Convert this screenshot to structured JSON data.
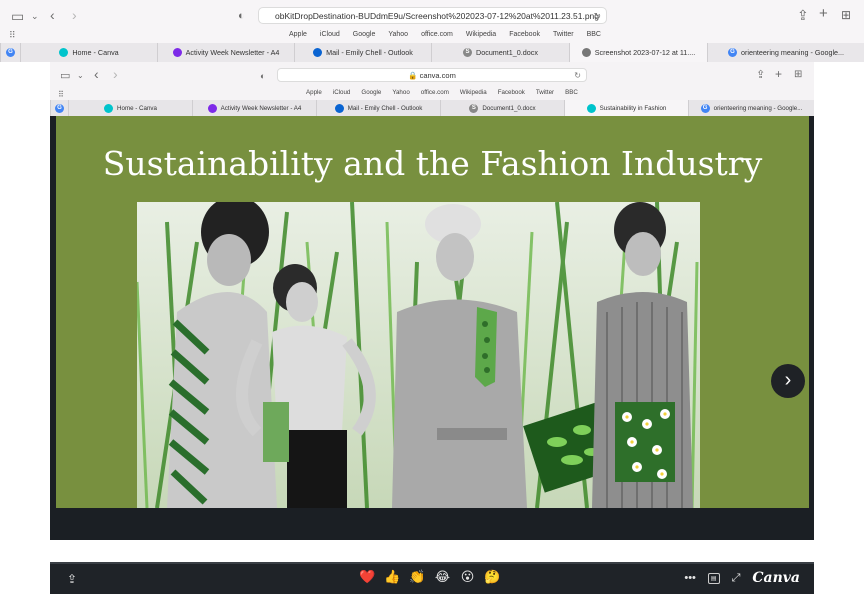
{
  "browser": {
    "url": "obKitDropDestination-BUDdmE9u/Screenshot%202023-07-12%20at%2011.23.51.png",
    "favorites": [
      "Apple",
      "iCloud",
      "Google",
      "Yahoo",
      "office.com",
      "Wikipedia",
      "Facebook",
      "Twitter",
      "BBC"
    ],
    "tabs": [
      {
        "label": "",
        "icon": "google-icon",
        "color": "#4285f4"
      },
      {
        "label": "Home - Canva",
        "icon": "canva-icon",
        "color": "#00c4cc"
      },
      {
        "label": "Activity Week Newsletter - A4",
        "icon": "canva-icon",
        "color": "#7d2ae8"
      },
      {
        "label": "Mail - Emily Chell - Outlook",
        "icon": "outlook-icon",
        "color": "#0a64d2"
      },
      {
        "label": "Document1_0.docx",
        "icon": "document-icon",
        "color": "#888888"
      },
      {
        "label": "Screenshot 2023-07-12 at 11....",
        "icon": "safari-icon",
        "color": "#777777"
      },
      {
        "label": "orienteering meaning - Google...",
        "icon": "google-icon",
        "color": "#4285f4"
      }
    ]
  },
  "inner": {
    "url": "canva.com",
    "favorites": [
      "Apple",
      "iCloud",
      "Google",
      "Yahoo",
      "office.com",
      "Wikipedia",
      "Facebook",
      "Twitter",
      "BBC"
    ],
    "tabs": [
      {
        "label": "",
        "icon": "google-icon",
        "color": "#4285f4"
      },
      {
        "label": "Home - Canva",
        "icon": "canva-icon",
        "color": "#00c4cc"
      },
      {
        "label": "Activity Week Newsletter - A4",
        "icon": "canva-icon",
        "color": "#7d2ae8"
      },
      {
        "label": "Mail - Emily Chell - Outlook",
        "icon": "outlook-icon",
        "color": "#0a64d2"
      },
      {
        "label": "Document1_0.docx",
        "icon": "document-icon",
        "color": "#888888"
      },
      {
        "label": "Sustainability in Fashion",
        "icon": "canva-icon",
        "color": "#00c4cc"
      },
      {
        "label": "orienteering meaning - Google...",
        "icon": "google-icon",
        "color": "#4285f4"
      }
    ]
  },
  "slide": {
    "title": "Sustainability and the Fashion Industry",
    "background": "#78903f",
    "photo_icon": "fashion-collage-image"
  },
  "presenter": {
    "reactions": [
      "❤️",
      "👍",
      "👏",
      "😂",
      "😮",
      "🤔"
    ],
    "brand": "Canva",
    "progress": 0.0
  }
}
